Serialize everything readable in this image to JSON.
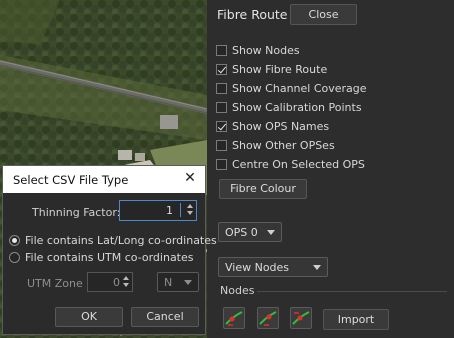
{
  "panel": {
    "title": "Fibre Route",
    "close_label": "Close",
    "checkboxes": [
      {
        "label": "Show Nodes",
        "checked": false
      },
      {
        "label": "Show Fibre Route",
        "checked": true
      },
      {
        "label": "Show Channel Coverage",
        "checked": false
      },
      {
        "label": "Show Calibration Points",
        "checked": false
      },
      {
        "label": "Show OPS Names",
        "checked": true
      },
      {
        "label": "Show Other OPSes",
        "checked": false
      },
      {
        "label": "Centre On Selected OPS",
        "checked": false
      }
    ],
    "fibre_colour_label": "Fibre Colour",
    "ops_select": "OPS 0",
    "view_select": "View Nodes",
    "nodes_group_label": "Nodes",
    "node_tool_icons": [
      "add-node-icon",
      "insert-node-icon",
      "remove-node-icon"
    ],
    "import_label": "Import"
  },
  "dialog": {
    "title": "Select CSV File Type",
    "close_glyph": "✕",
    "thinning_factor_label": "Thinning Factor:",
    "thinning_factor_value": "1",
    "radio_latlong_label": "File contains Lat/Long co-ordinates",
    "radio_latlong_selected": true,
    "radio_utm_label": "File contains UTM co-ordinates",
    "radio_utm_selected": false,
    "utm_zone_label": "UTM Zone",
    "utm_zone_value": "0",
    "hemisphere_value": "N",
    "ok_label": "OK",
    "cancel_label": "Cancel"
  },
  "colors": {
    "panel_bg": "#2d2d2d",
    "focus_border": "#4e89c9",
    "node_icon_green": "#2fbf3a",
    "node_icon_red": "#e0302a"
  }
}
